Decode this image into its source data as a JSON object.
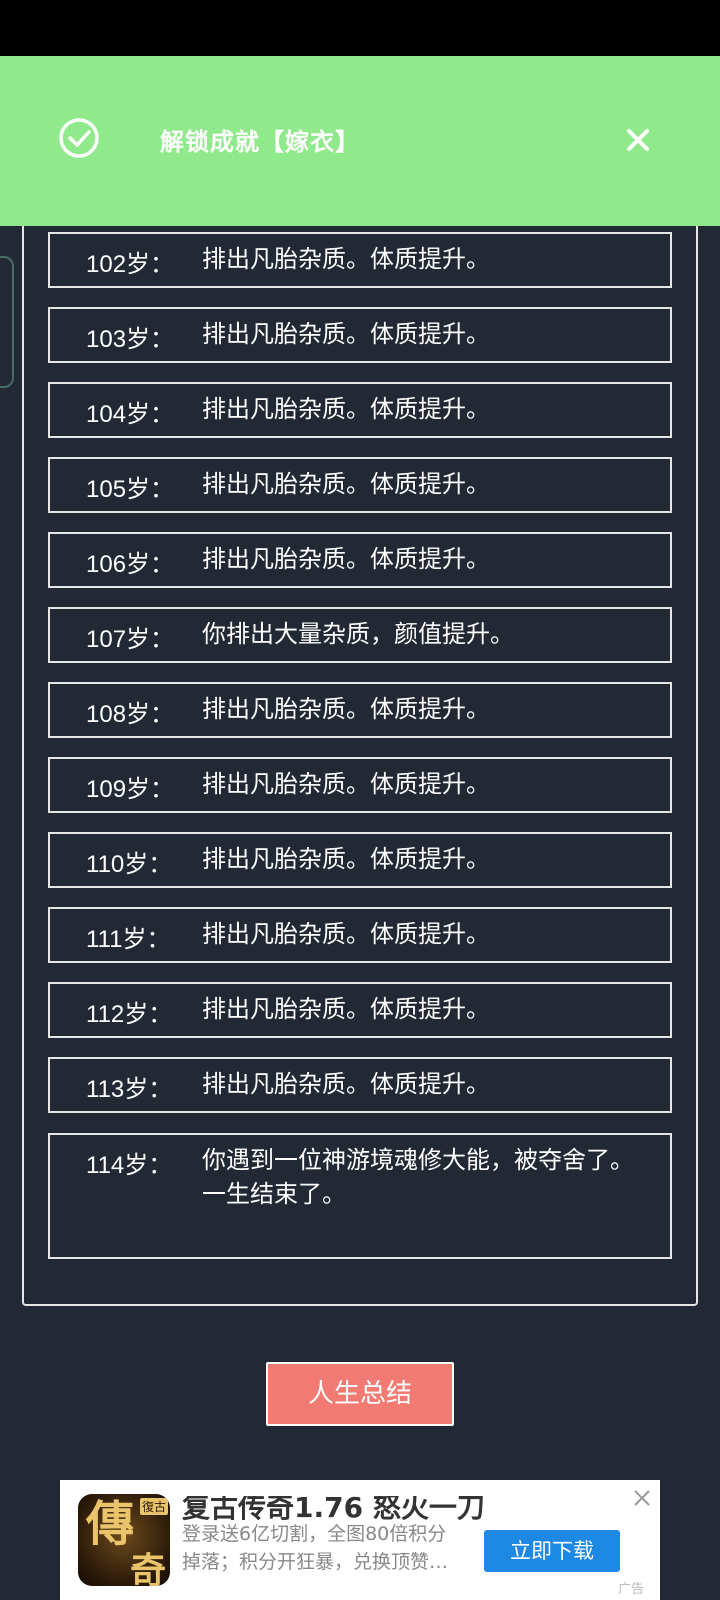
{
  "toast": {
    "icon": "check-circle-icon",
    "message": "解锁成就【嫁衣】",
    "close_icon": "close-icon"
  },
  "log": [
    {
      "age": "102岁：",
      "text": "排出凡胎杂质。体质提升。"
    },
    {
      "age": "103岁：",
      "text": "排出凡胎杂质。体质提升。"
    },
    {
      "age": "104岁：",
      "text": "排出凡胎杂质。体质提升。"
    },
    {
      "age": "105岁：",
      "text": "排出凡胎杂质。体质提升。"
    },
    {
      "age": "106岁：",
      "text": "排出凡胎杂质。体质提升。"
    },
    {
      "age": "107岁：",
      "text": "你排出大量杂质，颜值提升。"
    },
    {
      "age": "108岁：",
      "text": "排出凡胎杂质。体质提升。"
    },
    {
      "age": "109岁：",
      "text": "排出凡胎杂质。体质提升。"
    },
    {
      "age": "110岁：",
      "text": "排出凡胎杂质。体质提升。"
    },
    {
      "age": "111岁：",
      "text": "排出凡胎杂质。体质提升。"
    },
    {
      "age": "112岁：",
      "text": "排出凡胎杂质。体质提升。"
    },
    {
      "age": "113岁：",
      "text": "排出凡胎杂质。体质提升。"
    },
    {
      "age": "114岁：",
      "text": "你遇到一位神游境魂修大能，被夺舍了。",
      "text2": "一生结束了。"
    }
  ],
  "summary_button": "人生总结",
  "ad": {
    "logo_main": "傳",
    "logo_sub": "奇",
    "logo_tag": "復古",
    "title": "复古传奇1.76 怒火一刀",
    "desc_line1": "登录送6亿切割，全图80倍积分",
    "desc_line2": "掉落；积分开狂暴，兑换顶赞…",
    "cta": "立即下载",
    "label": "广告"
  },
  "colors": {
    "background": "#222834",
    "toast": "#90EA8C",
    "summary_button": "#F17A73",
    "ad_cta": "#1E88E5"
  }
}
